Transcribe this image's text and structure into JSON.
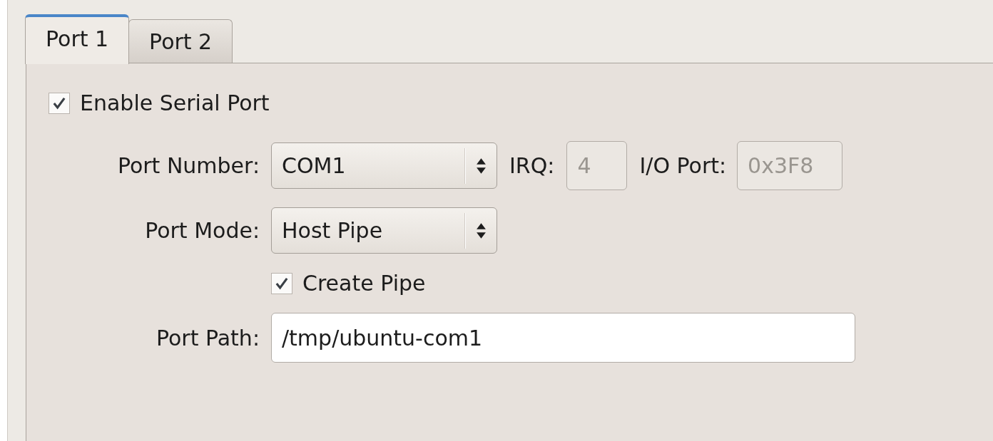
{
  "tabs": [
    {
      "label": "Port 1",
      "selected": true
    },
    {
      "label": "Port 2",
      "selected": false
    }
  ],
  "enable_serial_port": {
    "label": "Enable Serial Port",
    "checked": true
  },
  "port_number": {
    "label": "Port Number:",
    "value": "COM1"
  },
  "irq": {
    "label": "IRQ:",
    "value": "4",
    "disabled": true
  },
  "io_port": {
    "label": "I/O Port:",
    "value": "0x3F8",
    "disabled": true
  },
  "port_mode": {
    "label": "Port Mode:",
    "value": "Host Pipe"
  },
  "create_pipe": {
    "label": "Create Pipe",
    "checked": true
  },
  "port_path": {
    "label": "Port Path:",
    "value": "/tmp/ubuntu-com1"
  }
}
